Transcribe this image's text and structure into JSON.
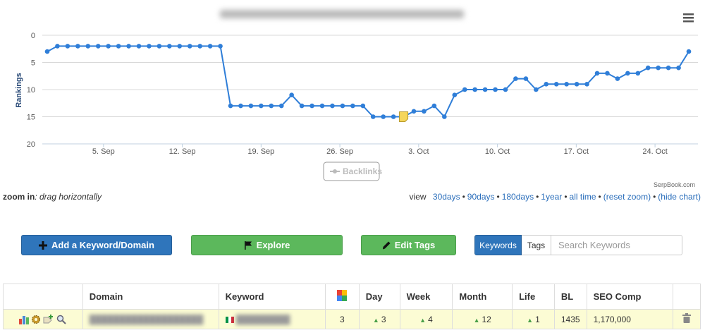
{
  "chart_data": {
    "type": "line",
    "title": "",
    "ylabel": "Rankings",
    "ylim": [
      20,
      0
    ],
    "yticks": [
      0,
      5,
      10,
      15,
      20
    ],
    "x_start": "2023-08-31",
    "x_end": "2023-10-27",
    "xtick_labels": [
      "5. Sep",
      "12. Sep",
      "19. Sep",
      "26. Sep",
      "3. Oct",
      "10. Oct",
      "17. Oct",
      "24. Oct"
    ],
    "grid": true,
    "legend_items": [
      "Backlinks"
    ],
    "credit": "SerpBook.com",
    "series": [
      {
        "values": [
          3,
          2,
          2,
          2,
          2,
          2,
          2,
          2,
          2,
          2,
          2,
          2,
          2,
          2,
          2,
          2,
          2,
          2,
          13,
          13,
          13,
          13,
          13,
          13,
          11,
          13,
          13,
          13,
          13,
          13,
          13,
          13,
          15,
          15,
          15,
          15,
          14,
          14,
          13,
          15,
          11,
          10,
          10,
          10,
          10,
          10,
          8,
          8,
          10,
          9,
          9,
          9,
          9,
          9,
          7,
          7,
          8,
          7,
          7,
          6,
          6,
          6,
          6,
          3
        ],
        "color": "#2f7ed8"
      }
    ],
    "annotation_marker": {
      "index": 35,
      "color": "#f5d65b"
    }
  },
  "zoom_hint": {
    "label": "zoom in",
    "text": ": drag horizontally"
  },
  "view_links": {
    "prefix": "view",
    "items": [
      "30days",
      "90days",
      "180days",
      "1year",
      "all time",
      "(reset zoom)",
      "(hide chart)"
    ]
  },
  "toolbar": {
    "add_label": "Add a Keyword/Domain",
    "explore_label": "Explore",
    "edit_tags_label": "Edit Tags",
    "segment_keywords": "Keywords",
    "segment_tags": "Tags",
    "search_placeholder": "Search Keywords"
  },
  "table": {
    "headers": [
      "Domain",
      "Keyword",
      "Day",
      "Week",
      "Month",
      "Life",
      "BL",
      "SEO Comp"
    ],
    "row": {
      "rank": "3",
      "day": "3",
      "week": "4",
      "month": "12",
      "life": "1",
      "bl": "1435",
      "seo_comp": "1,170,000"
    }
  },
  "colors": {
    "line": "#2f7ed8",
    "primary": "#2f75bb",
    "success": "#5cb85c",
    "row_highlight": "#fcfcd4"
  }
}
